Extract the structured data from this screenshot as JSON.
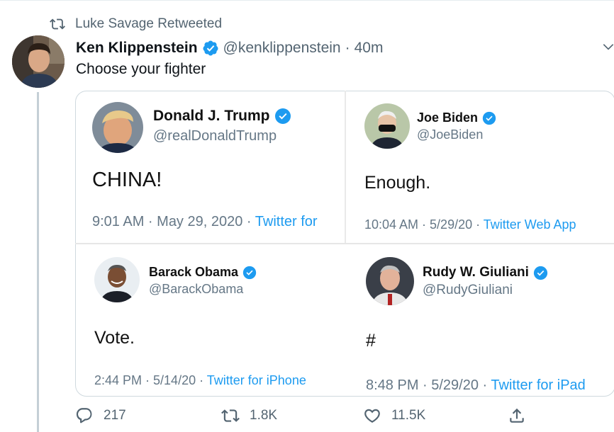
{
  "retweet": {
    "label": "Luke Savage Retweeted",
    "icon": "retweet-icon"
  },
  "tweet": {
    "author_name": "Ken Klippenstein",
    "handle": "@kenklippenstein",
    "separator": "·",
    "time": "40m",
    "text": "Choose your fighter"
  },
  "embedded": [
    {
      "name": "Donald J. Trump",
      "handle": "@realDonaldTrump",
      "text": "CHINA!",
      "meta": "9:01 AM · May 29, 2020 ·",
      "source": "Twitter for"
    },
    {
      "name": "Joe Biden",
      "handle": "@JoeBiden",
      "text": "Enough.",
      "meta": "10:04 AM · 5/29/20 ·",
      "source": "Twitter Web App"
    },
    {
      "name": "Barack Obama",
      "handle": "@BarackObama",
      "text": "Vote.",
      "meta": "2:44 PM · 5/14/20 ·",
      "source": "Twitter for iPhone"
    },
    {
      "name": "Rudy W. Giuliani",
      "handle": "@RudyGiuliani",
      "text": "#",
      "meta": "8:48 PM · 5/29/20 ·",
      "source": "Twitter for iPad"
    }
  ],
  "actions": {
    "replies": "217",
    "retweets": "1.8K",
    "likes": "11.5K"
  },
  "colors": {
    "verified": "#1d9bf0",
    "link": "#1d9bf0",
    "muted": "#536471",
    "border": "#cfd9de"
  }
}
